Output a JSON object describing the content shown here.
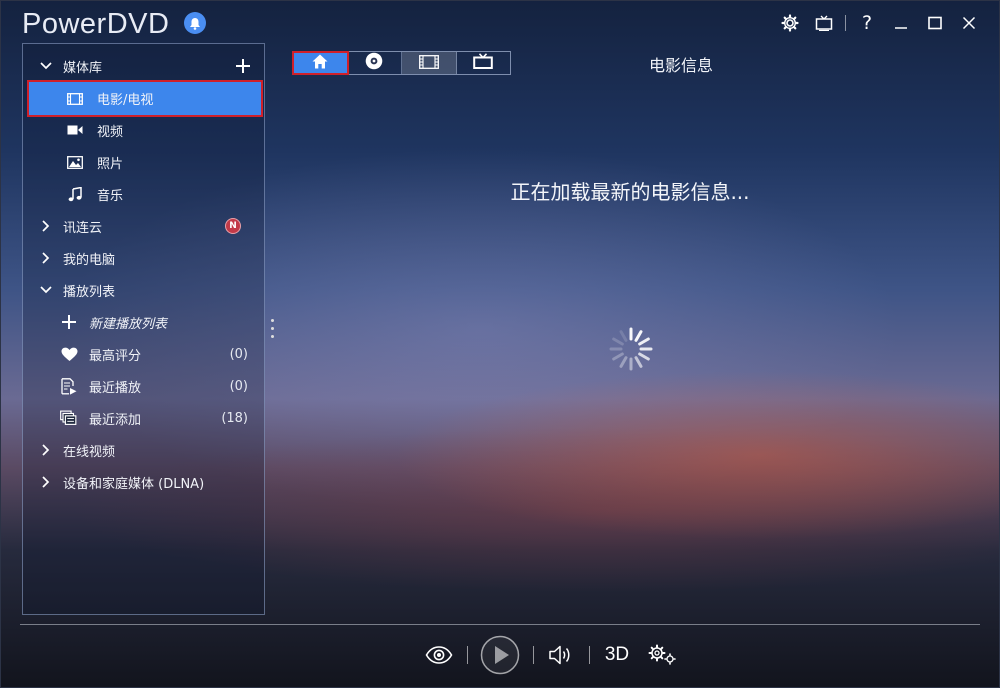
{
  "app": {
    "title": "PowerDVD"
  },
  "header": {
    "icons": [
      "bell-icon",
      "gear-icon",
      "tv-icon",
      "help-icon",
      "minimize-icon",
      "maximize-icon",
      "close-icon"
    ],
    "help_glyph": "?"
  },
  "sidebar": {
    "media_library": {
      "label": "媒体库"
    },
    "items": [
      {
        "label": "电影/电视",
        "icon": "film-icon",
        "selected": true
      },
      {
        "label": "视频",
        "icon": "video-camera-icon"
      },
      {
        "label": "照片",
        "icon": "photo-icon"
      },
      {
        "label": "音乐",
        "icon": "music-note-icon"
      }
    ],
    "cloud": {
      "label": "讯连云",
      "badge": "N"
    },
    "my_computer": {
      "label": "我的电脑"
    },
    "playlists": {
      "label": "播放列表",
      "new_label": "新建播放列表",
      "items": [
        {
          "label": "最高评分",
          "count": "(0)",
          "icon": "heart-icon"
        },
        {
          "label": "最近播放",
          "count": "(0)",
          "icon": "recent-play-icon"
        },
        {
          "label": "最近添加",
          "count": "(18)",
          "icon": "recent-add-icon"
        }
      ]
    },
    "online_video": {
      "label": "在线视频"
    },
    "dlna": {
      "label": "设备和家庭媒体 (DLNA)"
    }
  },
  "tabs": [
    {
      "icon": "home-icon",
      "active": true
    },
    {
      "icon": "disc-icon"
    },
    {
      "icon": "film-strip-icon"
    },
    {
      "icon": "tv-icon"
    }
  ],
  "main": {
    "title": "电影信息",
    "loading_message": "正在加载最新的电影信息..."
  },
  "player": {
    "three_d_label": "3D",
    "icons": [
      "eye-icon",
      "play-icon",
      "volume-icon",
      "settings-icon"
    ]
  },
  "colors": {
    "accent": "#3d86ec",
    "highlight_border": "#d0202a",
    "badge": "#c23a48"
  }
}
